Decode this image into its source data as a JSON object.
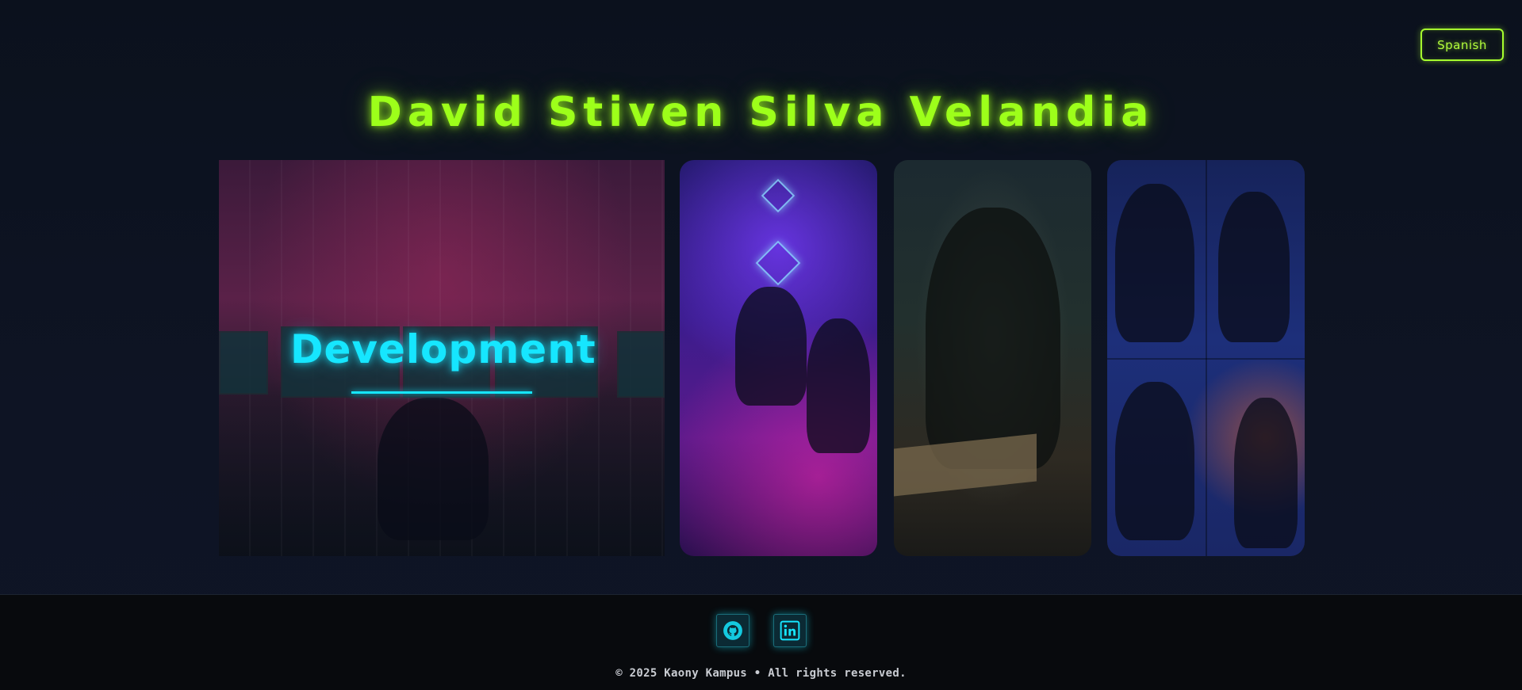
{
  "header": {
    "language_button": "Spanish",
    "title": "David Stiven Silva Velandia"
  },
  "gallery": {
    "featured_label": "Development",
    "cards": [
      {
        "name": "development-card"
      },
      {
        "name": "coding-team-card"
      },
      {
        "name": "reading-writer-card"
      },
      {
        "name": "cyber-rider-card"
      }
    ]
  },
  "footer": {
    "social_links": [
      {
        "icon": "github-icon"
      },
      {
        "icon": "linkedin-icon"
      }
    ],
    "copyright": "© 2025 Kaony Kampus • All rights reserved."
  },
  "colors": {
    "title": "#9dff1a",
    "accent_cyan": "#16e6ff",
    "background": "#0c1220",
    "footer_background": "#080a0d"
  }
}
